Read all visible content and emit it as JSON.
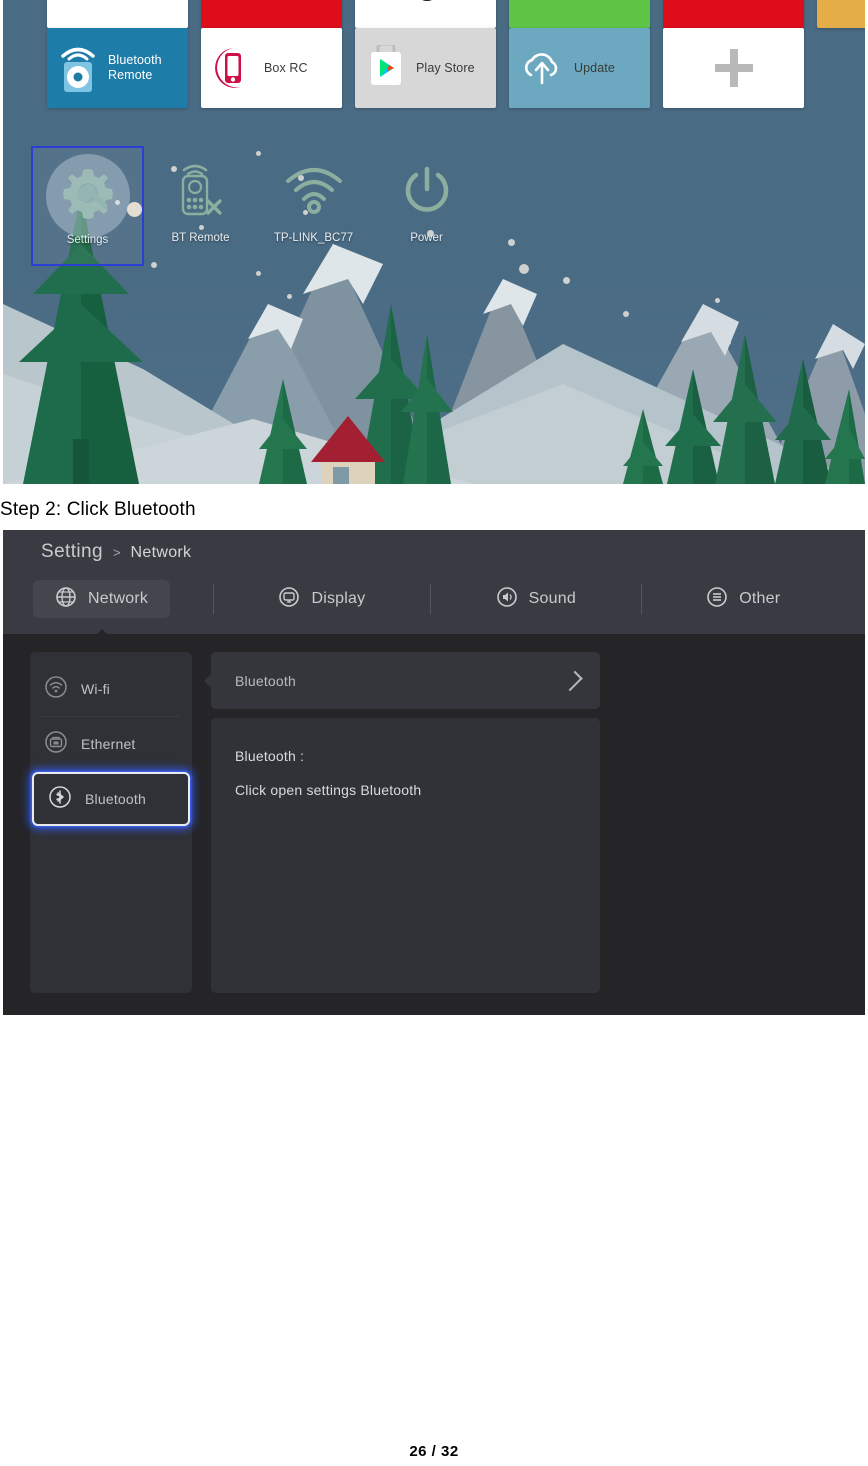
{
  "document": {
    "step_caption": "Step 2: Click Bluetooth",
    "footer": "26 / 32"
  },
  "launcher": {
    "tiles_top": [
      {
        "name": "tile-white-blank",
        "label": "",
        "color": "#ffffff",
        "icon": "blank-icon"
      },
      {
        "name": "tile-red-app",
        "label": "",
        "color": "#dd0d1c",
        "icon": "netflix-icon"
      },
      {
        "name": "tile-white-video",
        "label": "",
        "color": "#ffffff",
        "icon": "video-icon"
      },
      {
        "name": "tile-green-app",
        "label": "",
        "color": "#5ec446",
        "icon": "green-app-icon"
      },
      {
        "name": "tile-red-app-2",
        "label": "",
        "color": "#dd0d1c",
        "icon": "red-app-icon"
      },
      {
        "name": "tile-orange-app",
        "label": "",
        "color": "#e5ad48",
        "icon": "amazon-icon"
      }
    ],
    "tiles_bottom": [
      {
        "name": "bluetooth-remote",
        "label": "Bluetooth\nRemote",
        "label_line1": "Bluetooth",
        "label_line2": "Remote",
        "color": "#1e7ca8",
        "icon": "bluetooth-remote-icon",
        "text": "light"
      },
      {
        "name": "box-rc",
        "label": "Box RC",
        "color": "#ffffff",
        "icon": "box-rc-icon",
        "text": "dark"
      },
      {
        "name": "play-store",
        "label": "Play Store",
        "color": "#d7d7d7",
        "icon": "play-store-icon",
        "text": "dark"
      },
      {
        "name": "update",
        "label": "Update",
        "color": "#6ca8bf",
        "icon": "cloud-update-icon",
        "text": "dark"
      },
      {
        "name": "add-tile",
        "label": "",
        "color": "#ffffff",
        "icon": "plus-icon",
        "text": "dark"
      }
    ],
    "desktop_icons": [
      {
        "name": "settings",
        "label": "Settings",
        "icon": "gear-wrench-icon",
        "selected": true
      },
      {
        "name": "bt-remote",
        "label": "BT Remote",
        "icon": "remote-control-icon",
        "selected": false
      },
      {
        "name": "wifi-network",
        "label": "TP-LINK_BC77",
        "icon": "wifi-icon",
        "selected": false
      },
      {
        "name": "power",
        "label": "Power",
        "icon": "power-icon",
        "selected": false
      }
    ],
    "colors": {
      "wallpaper_sky": "#4a6b84",
      "selection_border": "#2b3fd4",
      "tree_dark": "#1f6b4b",
      "snow": "#c7d3d9"
    }
  },
  "settings": {
    "breadcrumb": {
      "root": "Setting",
      "separator": ">",
      "leaf": "Network"
    },
    "tabs": [
      {
        "name": "tab-network",
        "label": "Network",
        "icon": "globe-icon",
        "active": true
      },
      {
        "name": "tab-display",
        "label": "Display",
        "icon": "monitor-icon",
        "active": false
      },
      {
        "name": "tab-sound",
        "label": "Sound",
        "icon": "speaker-icon",
        "active": false
      },
      {
        "name": "tab-other",
        "label": "Other",
        "icon": "list-icon",
        "active": false
      }
    ],
    "sidebar": [
      {
        "name": "sidebar-item-wifi",
        "label": "Wi-fi",
        "icon": "wifi-circle-icon",
        "focused": false
      },
      {
        "name": "sidebar-item-ethernet",
        "label": "Ethernet",
        "icon": "ethernet-circle-icon",
        "focused": false
      },
      {
        "name": "sidebar-item-bluetooth",
        "label": "Bluetooth",
        "icon": "bluetooth-circle-icon",
        "focused": true
      }
    ],
    "detail": {
      "row_label": "Bluetooth",
      "row_chevron": "chevron-right-icon",
      "info_title": "Bluetooth :",
      "info_body": "Click open settings Bluetooth"
    },
    "colors": {
      "header_bg": "#3a3b42",
      "body_bg": "#252528",
      "card_bg": "#35363b",
      "focus_glow": "#315cff",
      "text_primary": "#d9dadd",
      "text_muted": "#b9bac0"
    }
  }
}
